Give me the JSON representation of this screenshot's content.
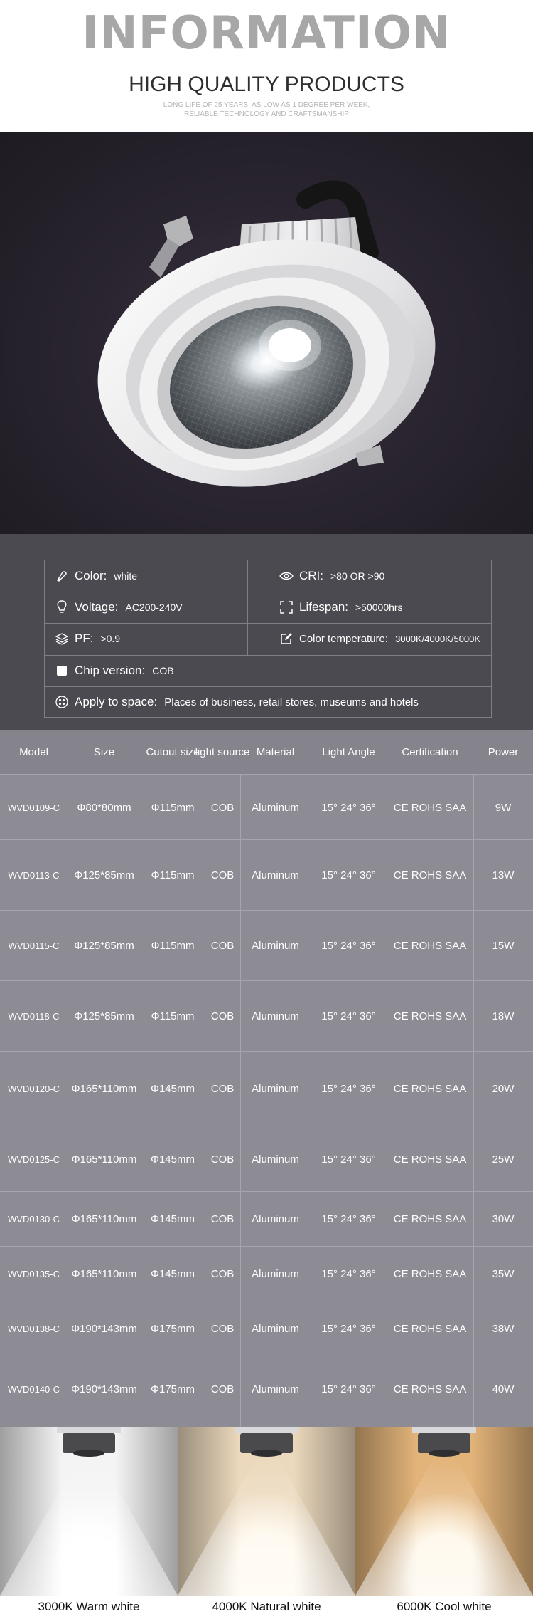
{
  "header": {
    "title": "INFORMATION",
    "subtitle": "HIGH QUALITY PRODUCTS",
    "tagline_1": "LONG LIFE OF 25 YEARS, AS LOW AS 1 DEGREE PER WEEK,",
    "tagline_2": "RELIABLE TECHNOLOGY AND CRAFTSMANSHIP"
  },
  "specs": {
    "color_label": "Color:",
    "color_value": "white",
    "cri_label": "CRI:",
    "cri_value": ">80 OR >90",
    "voltage_label": "Voltage:",
    "voltage_value": "AC200-240V",
    "lifespan_label": "Lifespan:",
    "lifespan_value": ">50000hrs",
    "pf_label": "PF:",
    "pf_value": ">0.9",
    "color_temp_label": "Color temperature:",
    "color_temp_value": "3000K/4000K/5000K",
    "chip_label": "Chip version:",
    "chip_value": "COB",
    "space_label": "Apply to space:",
    "space_value": "Places of business, retail stores, museums and hotels"
  },
  "table": {
    "headers": [
      "Model",
      "Size",
      "Cutout size",
      "light source",
      "Material",
      "Light Angle",
      "Certification",
      "Power"
    ],
    "rows": [
      [
        "WVD0109-C",
        "Φ80*80mm",
        "Φ115mm",
        "COB",
        "Aluminum",
        "15° 24° 36°",
        "CE ROHS SAA",
        "9W"
      ],
      [
        "WVD0113-C",
        "Φ125*85mm",
        "Φ115mm",
        "COB",
        "Aluminum",
        "15° 24° 36°",
        "CE ROHS SAA",
        "13W"
      ],
      [
        "WVD0115-C",
        "Φ125*85mm",
        "Φ115mm",
        "COB",
        "Aluminum",
        "15° 24° 36°",
        "CE ROHS SAA",
        "15W"
      ],
      [
        "WVD0118-C",
        "Φ125*85mm",
        "Φ115mm",
        "COB",
        "Aluminum",
        "15° 24° 36°",
        "CE ROHS SAA",
        "18W"
      ],
      [
        "WVD0120-C",
        "Φ165*110mm",
        "Φ145mm",
        "COB",
        "Aluminum",
        "15° 24° 36°",
        "CE ROHS SAA",
        "20W"
      ],
      [
        "WVD0125-C",
        "Φ165*110mm",
        "Φ145mm",
        "COB",
        "Aluminum",
        "15° 24° 36°",
        "CE ROHS SAA",
        "25W"
      ],
      [
        "WVD0130-C",
        "Φ165*110mm",
        "Φ145mm",
        "COB",
        "Aluminum",
        "15° 24° 36°",
        "CE ROHS SAA",
        "30W"
      ],
      [
        "WVD0135-C",
        "Φ165*110mm",
        "Φ145mm",
        "COB",
        "Aluminum",
        "15° 24° 36°",
        "CE ROHS SAA",
        "35W"
      ],
      [
        "WVD0138-C",
        "Φ190*143mm",
        "Φ175mm",
        "COB",
        "Aluminum",
        "15° 24° 36°",
        "CE ROHS SAA",
        "38W"
      ],
      [
        "WVD0140-C",
        "Φ190*143mm",
        "Φ175mm",
        "COB",
        "Aluminum",
        "15° 24° 36°",
        "CE ROHS SAA",
        "40W"
      ]
    ]
  },
  "temperatures": [
    {
      "label": "3000K Warm white",
      "tone": "#f4f4f4",
      "glow": "#ffffff"
    },
    {
      "label": "4000K Natural white",
      "tone": "#ecd9bd",
      "glow": "#fff8ea"
    },
    {
      "label": "6000K Cool white",
      "tone": "#e3b47a",
      "glow": "#fff6e4"
    }
  ],
  "colors": {
    "specs_bg": "#4b4a50",
    "table_bg": "#8d8c94",
    "title_gray": "#a7a7a7"
  }
}
